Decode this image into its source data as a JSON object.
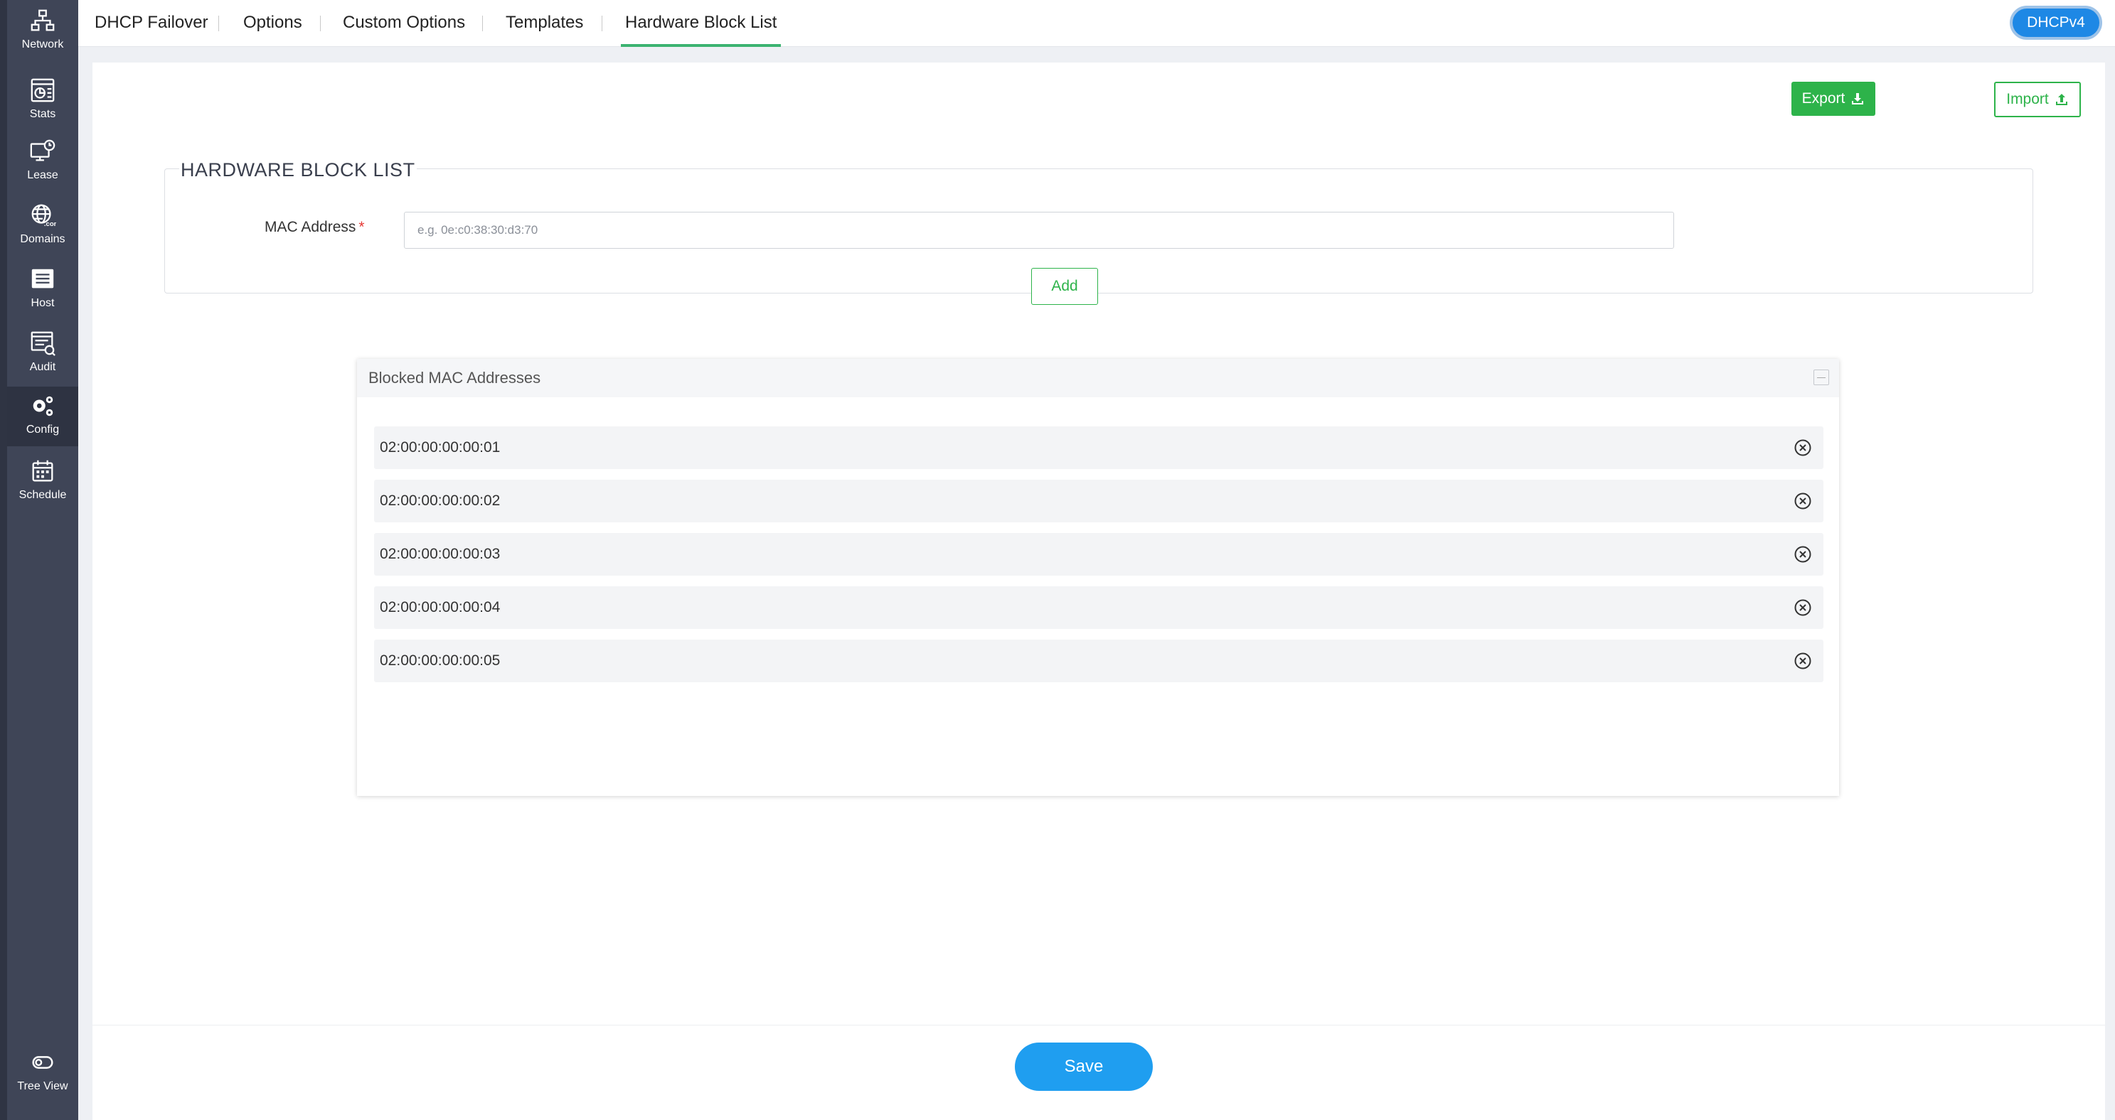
{
  "sidebar": {
    "items": [
      {
        "label": "Network",
        "icon": "network-icon"
      },
      {
        "label": "Stats",
        "icon": "stats-icon"
      },
      {
        "label": "Lease",
        "icon": "lease-icon"
      },
      {
        "label": "Domains",
        "icon": "domains-icon"
      },
      {
        "label": "Host",
        "icon": "host-icon"
      },
      {
        "label": "Audit",
        "icon": "audit-icon"
      },
      {
        "label": "Config",
        "icon": "config-icon",
        "active": true
      },
      {
        "label": "Schedule",
        "icon": "schedule-icon"
      }
    ],
    "tree_view": {
      "label": "Tree View",
      "icon": "toggle-icon"
    }
  },
  "tabs": [
    {
      "label": "DHCP Failover"
    },
    {
      "label": "Options"
    },
    {
      "label": "Custom Options"
    },
    {
      "label": "Templates"
    },
    {
      "label": "Hardware Block List",
      "active": true
    }
  ],
  "protocol_badge": "DHCPv4",
  "actions": {
    "export_label": "Export",
    "import_label": "Import"
  },
  "form": {
    "section_title": "HARDWARE BLOCK LIST",
    "mac_label": "MAC Address",
    "required_mark": "*",
    "mac_placeholder": "e.g. 0e:c0:38:30:d3:70",
    "mac_value": "",
    "add_label": "Add"
  },
  "blocked_list": {
    "title": "Blocked MAC Addresses",
    "items": [
      "02:00:00:00:00:01",
      "02:00:00:00:00:02",
      "02:00:00:00:00:03",
      "02:00:00:00:00:04",
      "02:00:00:00:00:05"
    ]
  },
  "save_label": "Save",
  "colors": {
    "sidebar_bg": "#3f4557",
    "accent_green": "#2db34a",
    "tab_underline": "#3cb371",
    "primary_blue": "#1f9ef0",
    "badge_blue": "#1e88e5"
  }
}
